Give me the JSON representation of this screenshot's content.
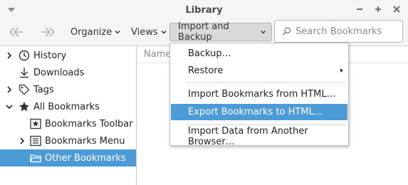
{
  "window": {
    "title": "Library"
  },
  "toolbar": {
    "organize_label": "Organize",
    "views_label": "Views",
    "import_backup_label": "Import and Backup",
    "search_placeholder": "Search Bookmarks"
  },
  "sidebar": {
    "items": [
      {
        "label": "History",
        "icon": "clock-icon",
        "twisty": "collapsed"
      },
      {
        "label": "Downloads",
        "icon": "download-icon",
        "twisty": "none"
      },
      {
        "label": "Tags",
        "icon": "tag-icon",
        "twisty": "collapsed"
      },
      {
        "label": "All Bookmarks",
        "icon": "star-icon",
        "twisty": "expanded"
      },
      {
        "label": "Bookmarks Toolbar",
        "icon": "bookmarks-toolbar-icon",
        "twisty": "none"
      },
      {
        "label": "Bookmarks Menu",
        "icon": "bookmarks-menu-icon",
        "twisty": "collapsed"
      },
      {
        "label": "Other Bookmarks",
        "icon": "folder-icon",
        "twisty": "none",
        "selected": true
      }
    ]
  },
  "main": {
    "column_header": "Name"
  },
  "dropdown": {
    "items": [
      {
        "label": "Backup…"
      },
      {
        "label": "Restore",
        "submenu": true
      },
      {
        "label": "Import Bookmarks from HTML…"
      },
      {
        "label": "Export Bookmarks to HTML…",
        "highlighted": true
      },
      {
        "label": "Import Data from Another Browser…"
      }
    ]
  },
  "colors": {
    "selection": "#4d9bd6",
    "window_bg": "#f5f5f5",
    "panel_bg": "#ffffff"
  }
}
